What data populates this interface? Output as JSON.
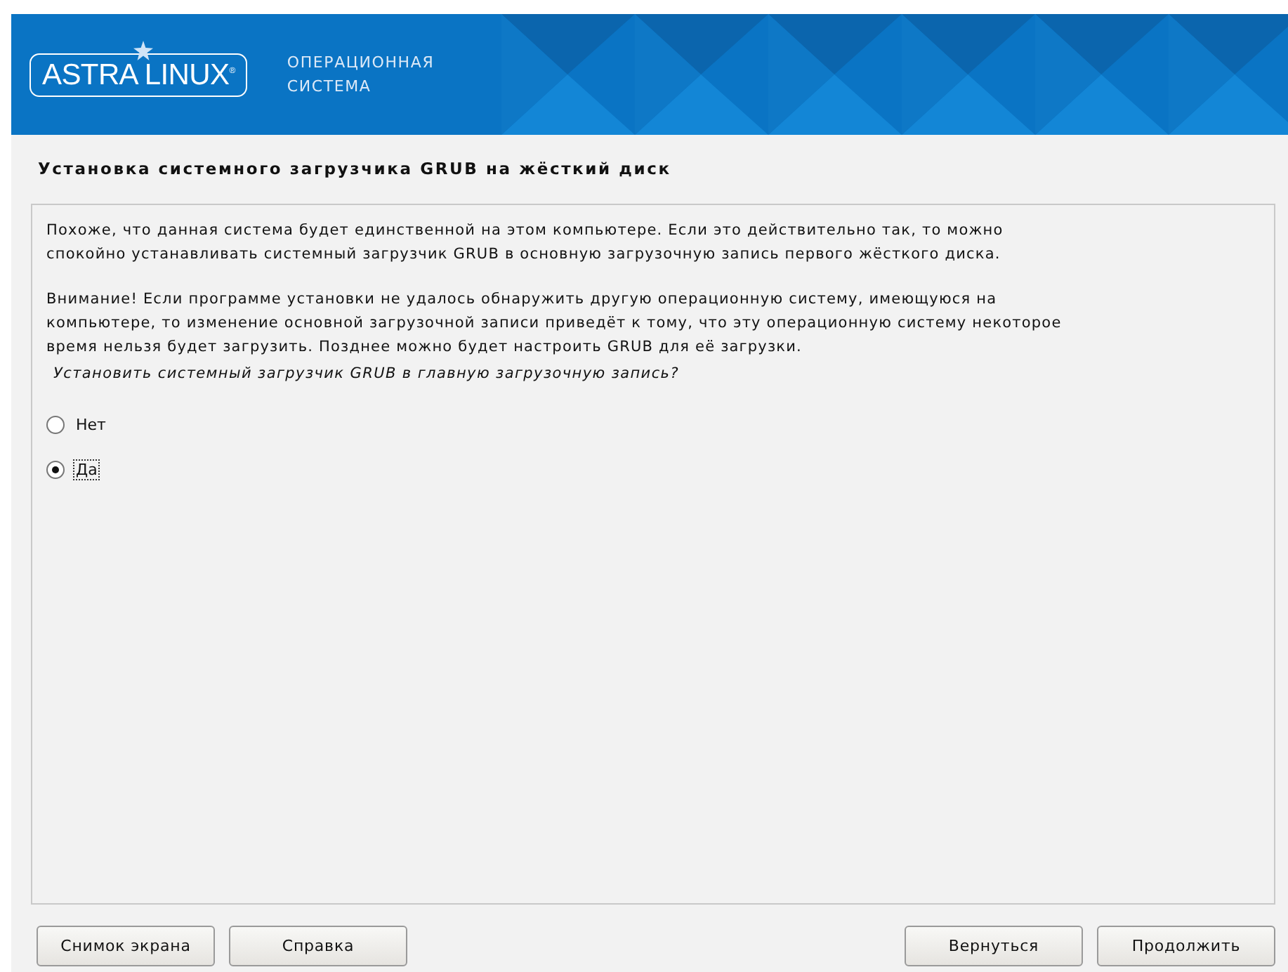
{
  "header": {
    "logo": "ASTRA LINUX$^{®}$",
    "subtitle_lines": [
      "ОПЕРАЦИОННАЯ",
      "СИСТЕМА"
    ]
  },
  "title": "Установка системного загрузчика GRUB на жёсткий диск",
  "paragraphs": [
    "Похоже, что данная система будет единственной на этом компьютере. Если это действительно так, то можно\nспокойно устанавливать системный загрузчик GRUB в основную загрузочную запись первого жёсткого диска.",
    "Внимание! Если программе установки не удалось обнаружить другую операционную систему, имеющуюся на\nкомпьютере, то изменение основной загрузочной записи приведёт к тому, что эту операционную систему некоторое\nвремя нельзя будет загрузить. Позднее можно будет настроить GRUB для её загрузки."
  ],
  "question": "Установить системный загрузчик GRUB в главную загрузочную запись?",
  "options": [
    {
      "label": "Нет",
      "selected": false
    },
    {
      "label": "Да",
      "selected": true
    }
  ],
  "left_buttons": [
    "Снимок экрана",
    "Справка"
  ],
  "right_buttons": [
    "Вернуться",
    "Продолжить"
  ]
}
